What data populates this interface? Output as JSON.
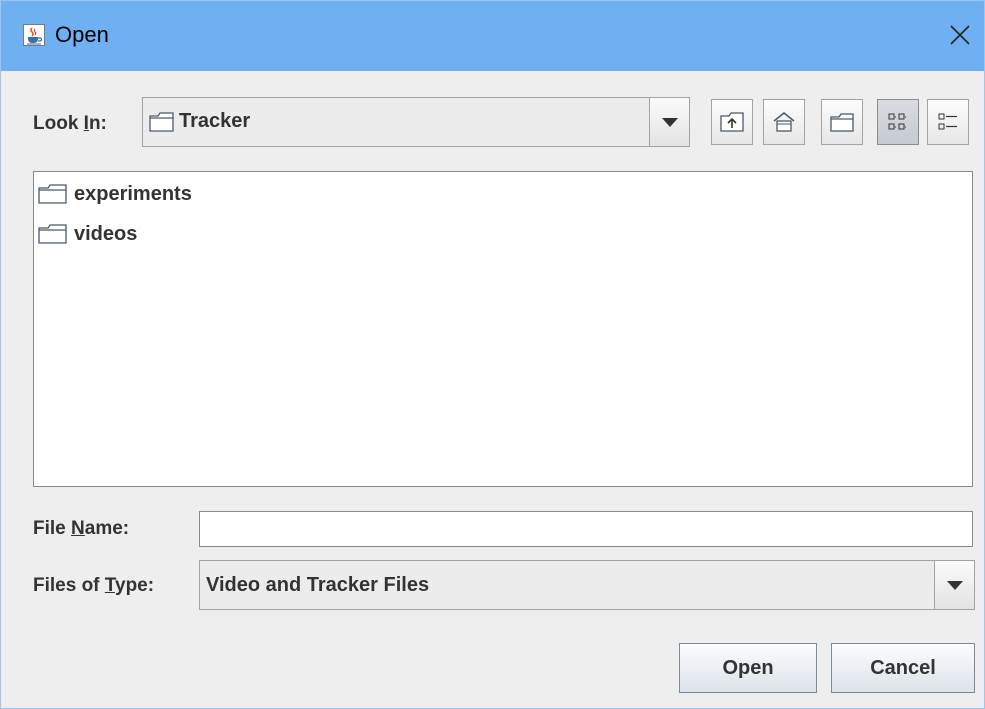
{
  "window": {
    "title": "Open"
  },
  "look_in": {
    "label_prefix": "Look ",
    "label_mnemonic": "I",
    "label_suffix": "n:",
    "value": "Tracker"
  },
  "toolbar": {
    "buttons": [
      {
        "name": "up-one-level",
        "icon": "folder-up-icon"
      },
      {
        "name": "home",
        "icon": "home-icon"
      },
      {
        "name": "create-new-folder",
        "icon": "new-folder-icon"
      },
      {
        "name": "list-view",
        "icon": "list-view-icon",
        "selected": true
      },
      {
        "name": "details-view",
        "icon": "details-view-icon",
        "selected": false
      }
    ]
  },
  "files": [
    {
      "label": "experiments",
      "icon": "folder-icon"
    },
    {
      "label": "videos",
      "icon": "folder-icon"
    }
  ],
  "file_name": {
    "label_prefix": "File ",
    "label_mnemonic": "N",
    "label_suffix": "ame:",
    "value": ""
  },
  "files_of_type": {
    "label_prefix": "Files of ",
    "label_mnemonic": "T",
    "label_suffix": "ype:",
    "value": "Video and Tracker Files"
  },
  "buttons": {
    "open_label": "Open",
    "cancel_label": "Cancel"
  },
  "colors": {
    "titlebar": "#6fb0f2",
    "dialog_bg": "#eeeeee",
    "text": "#333333"
  }
}
